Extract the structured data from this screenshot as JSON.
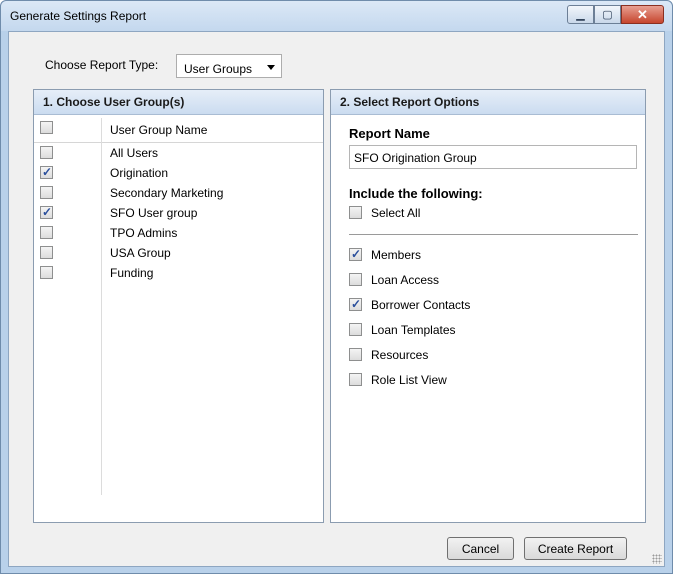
{
  "window": {
    "title": "Generate Settings Report"
  },
  "report_type": {
    "label": "Choose Report Type:",
    "value": "User Groups"
  },
  "left_panel": {
    "header": "1. Choose User Group(s)",
    "column_title": "User Group Name",
    "select_all_checked": false,
    "rows": [
      {
        "name": "All Users",
        "checked": false
      },
      {
        "name": "Origination",
        "checked": true
      },
      {
        "name": "Secondary Marketing",
        "checked": false
      },
      {
        "name": "SFO User group",
        "checked": true
      },
      {
        "name": "TPO Admins",
        "checked": false
      },
      {
        "name": "USA Group",
        "checked": false
      },
      {
        "name": "Funding",
        "checked": false
      }
    ]
  },
  "right_panel": {
    "header": "2. Select Report Options",
    "report_name_label": "Report Name",
    "report_name_value": "SFO Origination Group",
    "include_label": "Include the following:",
    "select_all": {
      "label": "Select All",
      "checked": false
    },
    "options": [
      {
        "label": "Members",
        "checked": true
      },
      {
        "label": "Loan Access",
        "checked": false
      },
      {
        "label": "Borrower Contacts",
        "checked": true
      },
      {
        "label": "Loan Templates",
        "checked": false
      },
      {
        "label": "Resources",
        "checked": false
      },
      {
        "label": "Role List View",
        "checked": false
      }
    ]
  },
  "buttons": {
    "cancel": "Cancel",
    "create": "Create Report"
  }
}
